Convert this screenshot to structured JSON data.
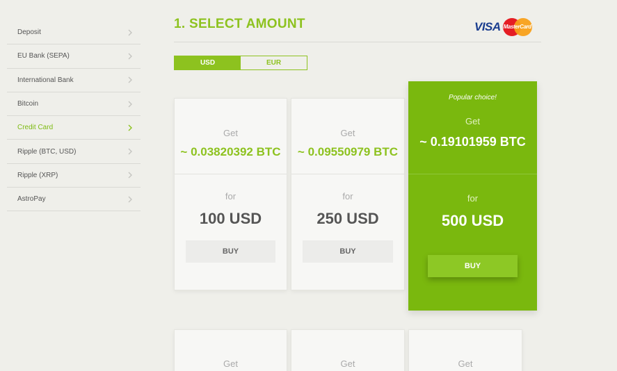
{
  "sidebar": {
    "items": [
      {
        "label": "Deposit"
      },
      {
        "label": "EU Bank (SEPA)"
      },
      {
        "label": "International Bank"
      },
      {
        "label": "Bitcoin"
      },
      {
        "label": "Credit Card"
      },
      {
        "label": "Ripple (BTC, USD)"
      },
      {
        "label": "Ripple (XRP)"
      },
      {
        "label": "AstroPay"
      }
    ],
    "active_index": 4
  },
  "header": {
    "title": "1. SELECT AMOUNT",
    "card_logos": {
      "visa": "VISA",
      "mastercard": "MasterCard"
    }
  },
  "currency_toggle": {
    "options": [
      "USD",
      "EUR"
    ],
    "selected": "USD"
  },
  "cards": [
    {
      "get_label": "Get",
      "btc": "~ 0.03820392 BTC",
      "for_label": "for",
      "amount": "100 USD",
      "buy_label": "BUY"
    },
    {
      "get_label": "Get",
      "btc": "~ 0.09550979 BTC",
      "for_label": "for",
      "amount": "250 USD",
      "buy_label": "BUY"
    },
    {
      "popular": "Popular choice!",
      "get_label": "Get",
      "btc": "~ 0.19101959 BTC",
      "for_label": "for",
      "amount": "500 USD",
      "buy_label": "BUY"
    }
  ],
  "cards_row2": [
    {
      "get_label": "Get"
    },
    {
      "get_label": "Get"
    },
    {
      "get_label": "Get"
    }
  ],
  "colors": {
    "accent": "#8dc21f",
    "featured": "#7ab80e",
    "background": "#efefea"
  }
}
